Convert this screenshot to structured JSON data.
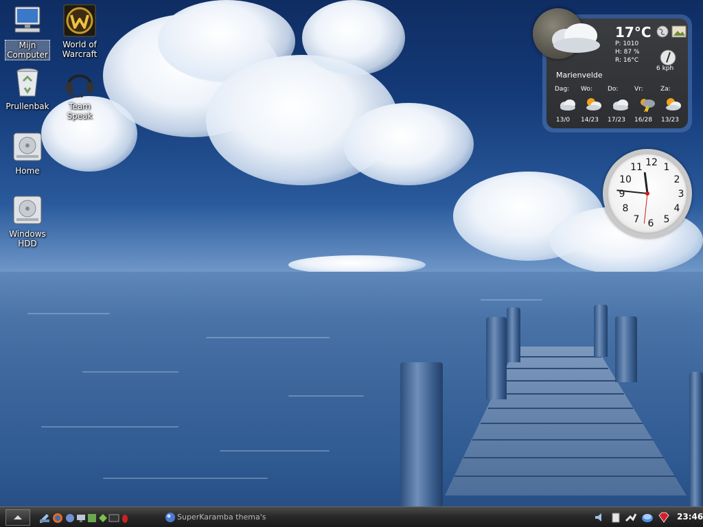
{
  "desktop": {
    "icons": [
      {
        "label": "Mijn\nComputer",
        "icon": "computer-icon"
      },
      {
        "label": "World of\nWarcraft",
        "icon": "world-of-warcraft-icon"
      },
      {
        "label": "Prullenbak",
        "icon": "trash-icon"
      },
      {
        "label": "Team\nSpeak",
        "icon": "headset-icon"
      },
      {
        "label": "Home",
        "icon": "hard-drive-icon"
      },
      {
        "label": "Windows\nHDD",
        "icon": "hard-drive-icon"
      }
    ]
  },
  "weather": {
    "temperature": "17°C",
    "pressure": "P:  1010",
    "humidity": "H:  87 %",
    "feels": "R:  16°C",
    "wind": "6 kph",
    "city": "Marienvelde",
    "days": [
      {
        "name": "Dag:",
        "range": "13/0",
        "icon": "cloudy-icon"
      },
      {
        "name": "Wo:",
        "range": "14/23",
        "icon": "partly-sunny-icon"
      },
      {
        "name": "Do:",
        "range": "17/23",
        "icon": "cloudy-icon"
      },
      {
        "name": "Vr:",
        "range": "16/28",
        "icon": "thunderstorm-icon"
      },
      {
        "name": "Za:",
        "range": "13/23",
        "icon": "partly-sunny-icon"
      }
    ]
  },
  "clock_widget": {
    "numbers": [
      "12",
      "1",
      "2",
      "3",
      "4",
      "5",
      "6",
      "7",
      "8",
      "9",
      "10",
      "11"
    ],
    "hour": 11,
    "minute": 46,
    "second": 31
  },
  "taskbar": {
    "active_task": "SuperKaramba thema's",
    "time": "23:46"
  },
  "colors": {
    "sky": "#143a78",
    "sea": "#3b659b",
    "taskbar": "#2a2a2a",
    "widget_panel": "#2c2e31"
  }
}
